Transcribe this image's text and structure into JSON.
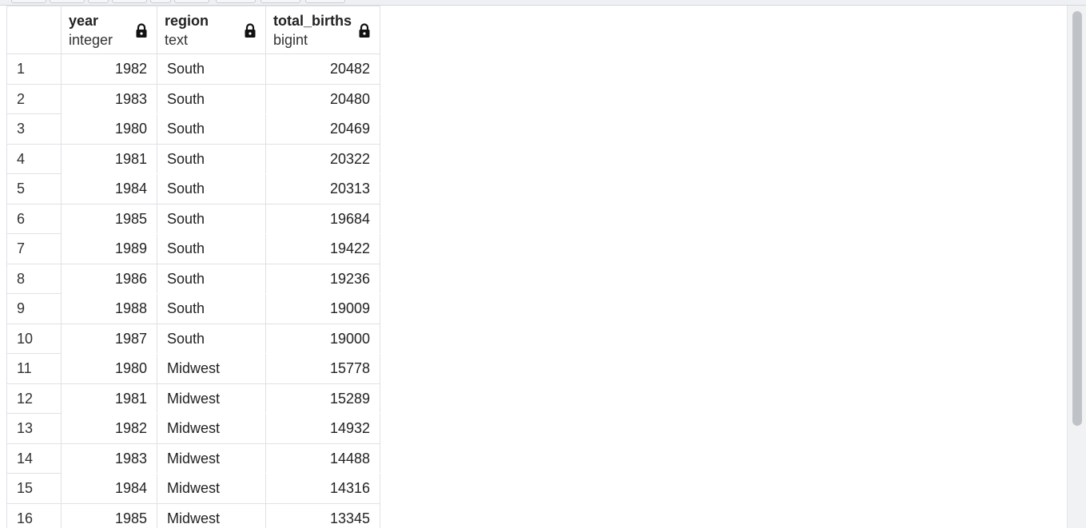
{
  "columns": [
    {
      "name": "year",
      "type": "integer",
      "align": "right",
      "icon": "lock-icon"
    },
    {
      "name": "region",
      "type": "text",
      "align": "left",
      "icon": "lock-icon"
    },
    {
      "name": "total_births",
      "type": "bigint",
      "align": "right",
      "icon": "lock-icon"
    }
  ],
  "rows": [
    {
      "num": "1",
      "year": "1982",
      "region": "South",
      "total_births": "20482"
    },
    {
      "num": "2",
      "year": "1983",
      "region": "South",
      "total_births": "20480"
    },
    {
      "num": "3",
      "year": "1980",
      "region": "South",
      "total_births": "20469"
    },
    {
      "num": "4",
      "year": "1981",
      "region": "South",
      "total_births": "20322"
    },
    {
      "num": "5",
      "year": "1984",
      "region": "South",
      "total_births": "20313"
    },
    {
      "num": "6",
      "year": "1985",
      "region": "South",
      "total_births": "19684"
    },
    {
      "num": "7",
      "year": "1989",
      "region": "South",
      "total_births": "19422"
    },
    {
      "num": "8",
      "year": "1986",
      "region": "South",
      "total_births": "19236"
    },
    {
      "num": "9",
      "year": "1988",
      "region": "South",
      "total_births": "19009"
    },
    {
      "num": "10",
      "year": "1987",
      "region": "South",
      "total_births": "19000"
    },
    {
      "num": "11",
      "year": "1980",
      "region": "Midwest",
      "total_births": "15778"
    },
    {
      "num": "12",
      "year": "1981",
      "region": "Midwest",
      "total_births": "15289"
    },
    {
      "num": "13",
      "year": "1982",
      "region": "Midwest",
      "total_births": "14932"
    },
    {
      "num": "14",
      "year": "1983",
      "region": "Midwest",
      "total_births": "14488"
    },
    {
      "num": "15",
      "year": "1984",
      "region": "Midwest",
      "total_births": "14316"
    },
    {
      "num": "16",
      "year": "1985",
      "region": "Midwest",
      "total_births": "13345"
    }
  ],
  "colors": {
    "border": "#dfe1e5",
    "scrollbar_thumb": "#bfc3c8",
    "text": "#222222"
  }
}
